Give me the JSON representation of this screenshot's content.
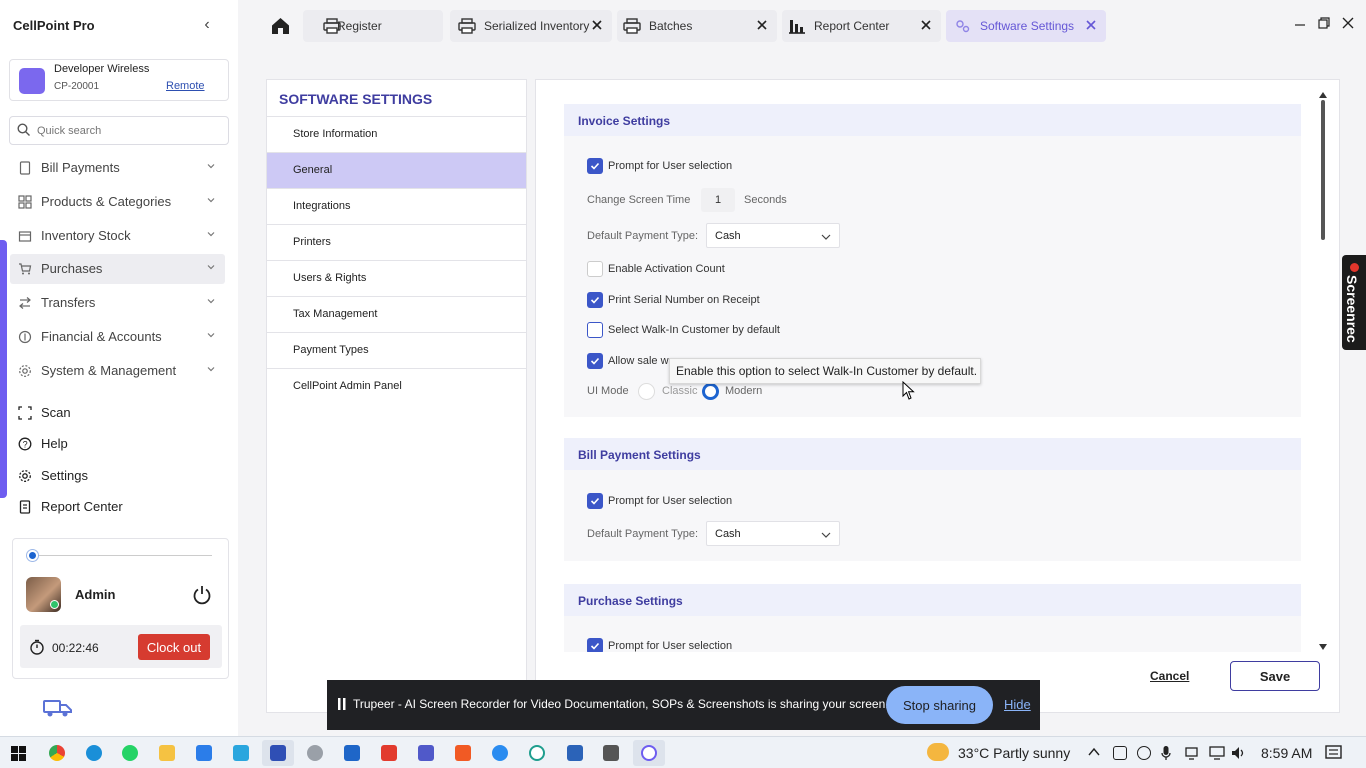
{
  "app": {
    "title": "CellPoint Pro"
  },
  "store": {
    "name": "Developer Wireless",
    "id": "CP-20001",
    "link": "Remote"
  },
  "search": {
    "placeholder": "Quick search"
  },
  "nav": {
    "items": [
      {
        "label": "Bill Payments",
        "icon": "receipt-icon"
      },
      {
        "label": "Products & Categories",
        "icon": "grid-icon"
      },
      {
        "label": "Inventory Stock",
        "icon": "box-icon"
      },
      {
        "label": "Purchases",
        "icon": "cart-icon"
      },
      {
        "label": "Transfers",
        "icon": "transfer-icon"
      },
      {
        "label": "Financial & Accounts",
        "icon": "finance-icon"
      },
      {
        "label": "System & Management",
        "icon": "gear-icon"
      }
    ],
    "bottom": [
      "Scan",
      "Help",
      "Settings",
      "Report Center"
    ]
  },
  "user": {
    "name": "Admin",
    "timer": "00:22:46",
    "clockout": "Clock out"
  },
  "tabs": [
    "Register",
    "Serialized Inventory",
    "Batches",
    "Report Center",
    "Software Settings"
  ],
  "settings_nav": {
    "title": "SOFTWARE SETTINGS",
    "items": [
      "Store Information",
      "General",
      "Integrations",
      "Printers",
      "Users & Rights",
      "Tax Management",
      "Payment Types",
      "CellPoint Admin Panel"
    ],
    "active": "General"
  },
  "invoice": {
    "title": "Invoice Settings",
    "prompt_user": "Prompt for User selection",
    "change_screen_label": "Change Screen Time",
    "change_screen_value": "1",
    "change_screen_unit": "Seconds",
    "payment_label": "Default Payment Type:",
    "payment_value": "Cash",
    "activation": "Enable Activation Count",
    "serial": "Print Serial Number on Receipt",
    "walkin": "Select Walk-In Customer by default",
    "allow_sale": "Allow sale w",
    "ui_mode_label": "UI Mode",
    "ui_classic": "Classic",
    "ui_modern": "Modern"
  },
  "tooltip": "Enable this option to select Walk-In Customer by default.",
  "bill_payment": {
    "title": "Bill Payment Settings",
    "prompt_user": "Prompt for User selection",
    "payment_label": "Default Payment Type:",
    "payment_value": "Cash"
  },
  "purchase": {
    "title": "Purchase Settings",
    "prompt_user": "Prompt for User selection"
  },
  "actions": {
    "cancel": "Cancel",
    "save": "Save"
  },
  "share_bar": {
    "text": "Trupeer - AI Screen Recorder for Video Documentation, SOPs & Screenshots is sharing your screen.",
    "stop": "Stop sharing",
    "hide": "Hide"
  },
  "screenrec": "Screenrec",
  "taskbar": {
    "weather": "33°C  Partly sunny",
    "time": "8:59 AM"
  },
  "colors": {
    "accent": "#3f3da0",
    "active_nav": "#cdc9f5",
    "check": "#3b56c8",
    "danger": "#d63b30"
  }
}
